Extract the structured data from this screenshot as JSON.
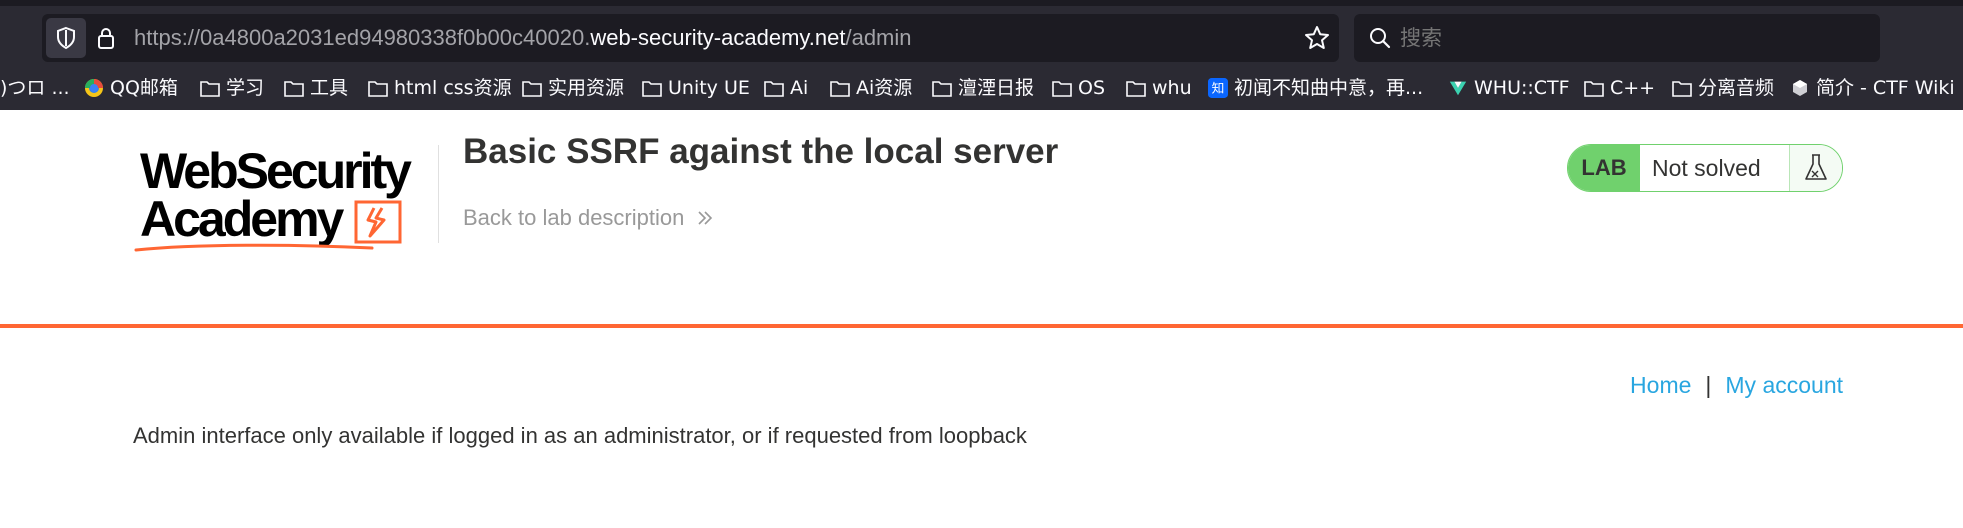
{
  "browser": {
    "url_prefix": "https://0a4800a2031ed94980338f0b00c40020.",
    "url_domain": "web-security-academy.net",
    "url_path": "/admin",
    "search_placeholder": "搜索",
    "bookmarks": [
      {
        "label": ")つロ ...",
        "icon": "none"
      },
      {
        "label": "QQ邮箱",
        "icon": "qq-mail-icon"
      },
      {
        "label": "学习",
        "icon": "folder-icon"
      },
      {
        "label": "工具",
        "icon": "folder-icon"
      },
      {
        "label": "html css资源",
        "icon": "folder-icon"
      },
      {
        "label": "实用资源",
        "icon": "folder-icon"
      },
      {
        "label": "Unity UE",
        "icon": "folder-icon"
      },
      {
        "label": "Ai",
        "icon": "folder-icon"
      },
      {
        "label": "Ai资源",
        "icon": "folder-icon"
      },
      {
        "label": "澶湮日报",
        "icon": "folder-icon"
      },
      {
        "label": "OS",
        "icon": "folder-icon"
      },
      {
        "label": "whu",
        "icon": "folder-icon"
      },
      {
        "label": "初闻不知曲中意，再...",
        "icon": "zhihu-icon"
      },
      {
        "label": "WHU::CTF",
        "icon": "whuctf-icon"
      },
      {
        "label": "C++",
        "icon": "folder-icon"
      },
      {
        "label": "分离音频",
        "icon": "folder-icon"
      },
      {
        "label": "简介 - CTF Wiki",
        "icon": "ctfwiki-icon"
      }
    ]
  },
  "header": {
    "logo_line1": "WebSecurity",
    "logo_line2": "Academy",
    "lab_title": "Basic SSRF against the local server",
    "back_link": "Back to lab description",
    "lab_badge": "LAB",
    "status": "Not solved"
  },
  "nav": {
    "home": "Home",
    "separator": "|",
    "my_account": "My account"
  },
  "main": {
    "message": "Admin interface only available if logged in as an administrator, or if requested from loopback"
  },
  "colors": {
    "accent_orange": "#ff6633",
    "lab_green": "#70d16d",
    "link_blue": "#29a6e0",
    "chrome_dark": "#2b2a33"
  }
}
